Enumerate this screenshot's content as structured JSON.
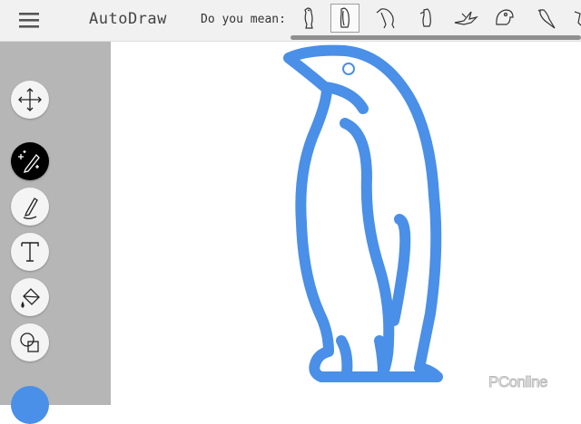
{
  "app": {
    "title": "AutoDraw"
  },
  "header": {
    "menu_icon": "hamburger-menu-icon",
    "prompt": "Do you mean:",
    "suggestions": [
      {
        "name": "penguin-standing",
        "selected": false
      },
      {
        "name": "penguin-emperor",
        "selected": true
      },
      {
        "name": "penguin-walking",
        "selected": false
      },
      {
        "name": "penguin-small",
        "selected": false
      },
      {
        "name": "bird-flying",
        "selected": false
      },
      {
        "name": "parrot-head",
        "selected": false
      },
      {
        "name": "parrot-perched",
        "selected": false
      },
      {
        "name": "bird-partial",
        "selected": false
      }
    ]
  },
  "tools": [
    {
      "name": "move",
      "icon": "move-arrows-icon",
      "active": false
    },
    {
      "name": "autodraw",
      "icon": "magic-pencil-icon",
      "active": true
    },
    {
      "name": "draw",
      "icon": "pencil-icon",
      "active": false
    },
    {
      "name": "type",
      "icon": "text-T-icon",
      "active": false
    },
    {
      "name": "fill",
      "icon": "paint-bucket-icon",
      "active": false
    },
    {
      "name": "shape",
      "icon": "shapes-icon",
      "active": false
    }
  ],
  "current_color": "#4a8fe8",
  "canvas": {
    "drawing": "penguin",
    "stroke_color": "#4a8fe8"
  },
  "watermark": {
    "text": "PConline"
  }
}
